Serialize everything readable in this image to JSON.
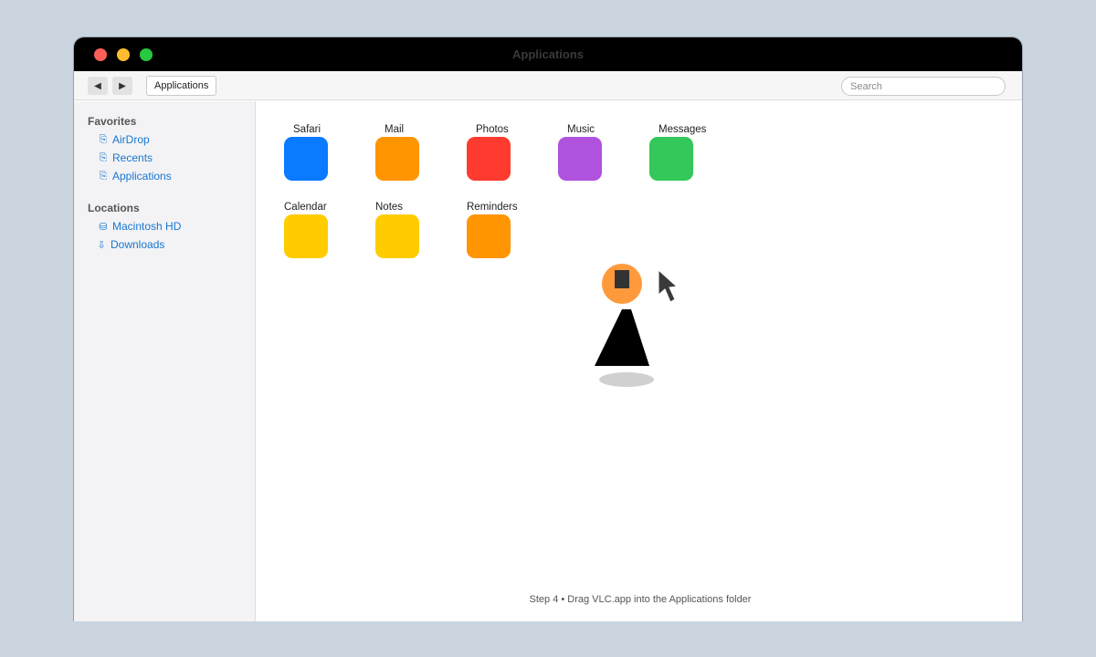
{
  "window": {
    "title": "Applications",
    "traffic_lights": {
      "close_color": "#ff5f57",
      "minimize_color": "#febc2e",
      "zoom_color": "#28c840"
    }
  },
  "toolbar": {
    "back_icon": "◀",
    "forward_icon": "▶",
    "path_label": "Applications",
    "search_placeholder": "Search"
  },
  "sidebar": {
    "favorites_title": "Favorites",
    "favorites": [
      {
        "label": "AirDrop",
        "icon": "folder-icon",
        "glyph": "⎘"
      },
      {
        "label": "Recents",
        "icon": "folder-icon",
        "glyph": "⎘"
      },
      {
        "label": "Applications",
        "icon": "folder-icon",
        "glyph": "⎘"
      }
    ],
    "locations_title": "Locations",
    "locations": [
      {
        "label": "Macintosh HD",
        "icon": "disk-icon",
        "glyph": "⛁"
      },
      {
        "label": "Downloads",
        "icon": "download-icon",
        "glyph": "⇩"
      }
    ]
  },
  "apps": [
    {
      "label": "Safari",
      "color": "#0a7aff"
    },
    {
      "label": "Mail",
      "color": "#ff9500"
    },
    {
      "label": "Photos",
      "color": "#ff3b30"
    },
    {
      "label": "Music",
      "color": "#af52de"
    },
    {
      "label": "Messages",
      "color": "#34c759"
    },
    {
      "label": "Calendar",
      "color": "#ffcc00"
    },
    {
      "label": "Notes",
      "color": "#ffcc00"
    },
    {
      "label": "Reminders",
      "color": "#ff9500"
    }
  ],
  "dragged_item": {
    "icon": "vlc-cone-icon",
    "head_color": "#ff9a3c",
    "cone_color": "#000000"
  },
  "caption": "Step 4 • Drag VLC.app into the Applications folder"
}
